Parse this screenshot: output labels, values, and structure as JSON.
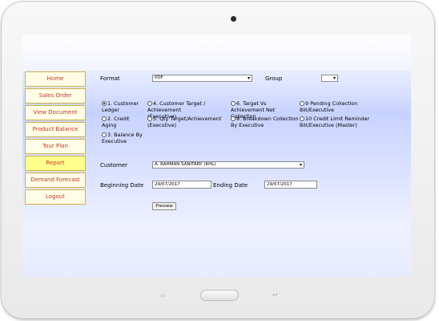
{
  "sidebar": {
    "items": [
      {
        "label": "Home"
      },
      {
        "label": "Sales Order"
      },
      {
        "label": "View Document"
      },
      {
        "label": "Product Balance"
      },
      {
        "label": "Tour Plan"
      },
      {
        "label": "Report"
      },
      {
        "label": "Demand Forecast"
      },
      {
        "label": "Logout"
      }
    ]
  },
  "form": {
    "format_label": "Format",
    "format_value": "PDF",
    "group_label": "Group",
    "group_value": "",
    "report_options": [
      {
        "label": "1. Customer Ledger",
        "selected": true
      },
      {
        "label": "4. Customer Target / Achievement (Executive)",
        "selected": false
      },
      {
        "label": "6. Target Vs Achievement Net Collection",
        "selected": false
      },
      {
        "label": "9 Pending Collection Bill/Executive",
        "selected": false
      },
      {
        "label": "2. Credit Aging",
        "selected": false
      },
      {
        "label": "5. Qty Target/Achievement (Executive)",
        "selected": false
      },
      {
        "label": "8. Breakdown Collection By Executive",
        "selected": false
      },
      {
        "label": "10 Credit Limit Reminder Bill/Executive (Master)",
        "selected": false
      },
      {
        "label": "3. Balance By Executive",
        "selected": false
      }
    ],
    "customer_label": "Customer",
    "customer_value": "A. RAHMAN SANITARY (KHL)",
    "beginning_date_label": "Beginning Date",
    "beginning_date_value": "29/07/2017",
    "ending_date_label": "Ending Date",
    "ending_date_value": "29/07/2017",
    "preview_label": "Preview"
  },
  "icons": {
    "chevron": "▾",
    "recent": "▭",
    "back": "↩"
  }
}
